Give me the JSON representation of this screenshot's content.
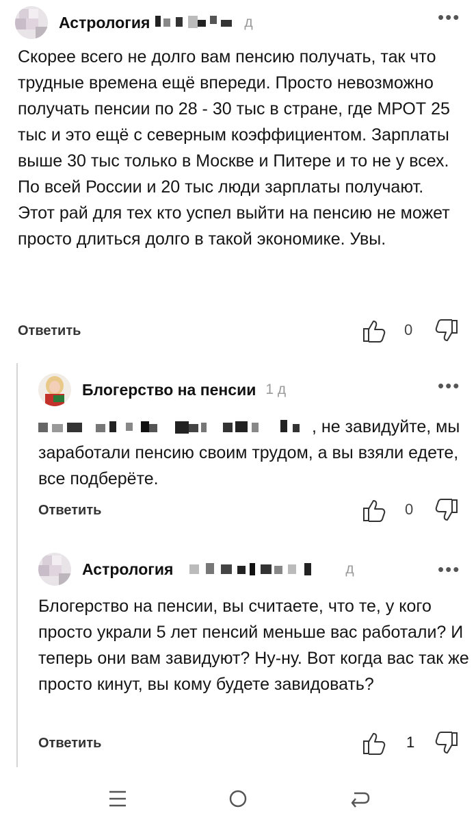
{
  "comments": [
    {
      "author": "Астрология",
      "date": "д",
      "text": "Скорее всего не долго вам пенсию получать, так что трудные времена ещё впереди. Просто невозможно получать пенсии по 28 - 30 тыс в стране, где МРОТ 25 тыс и это ещё с северным коэффициентом. Зарплаты выше 30 тыс только в Москве и Питере и то не у всех. По всей России и 20 тыс люди зарплаты получают. Этот рай для тех кто успел выйти на пенсию не может просто длиться долго в такой экономике. Увы.",
      "reply_label": "Ответить",
      "likes": "0"
    },
    {
      "author": "Блогерство на пенсии",
      "date": "1 д",
      "text": ", не завидуйте, мы заработали пенсию своим трудом, а вы взяли едете, все подберёте.",
      "reply_label": "Ответить",
      "likes": "0"
    },
    {
      "author": "Астрология",
      "date": "д",
      "text": "Блогерство на пенсии, вы считаете, что те, у кого просто украли 5 лет пенсий меньше вас работали? И теперь они вам завидуют? Ну-ну. Вот когда вас так же просто кинут, вы кому будете завидовать?",
      "reply_label": "Ответить",
      "likes": "1"
    }
  ],
  "icons": {
    "more": "more-dots-icon",
    "like": "thumb-up-icon",
    "dislike": "thumb-down-icon",
    "nav_menu": "menu-icon",
    "nav_home": "home-circle-icon",
    "nav_back": "back-arrow-icon"
  },
  "colors": {
    "date": "#9a9a9a",
    "thread_line": "#d5d5d5"
  }
}
